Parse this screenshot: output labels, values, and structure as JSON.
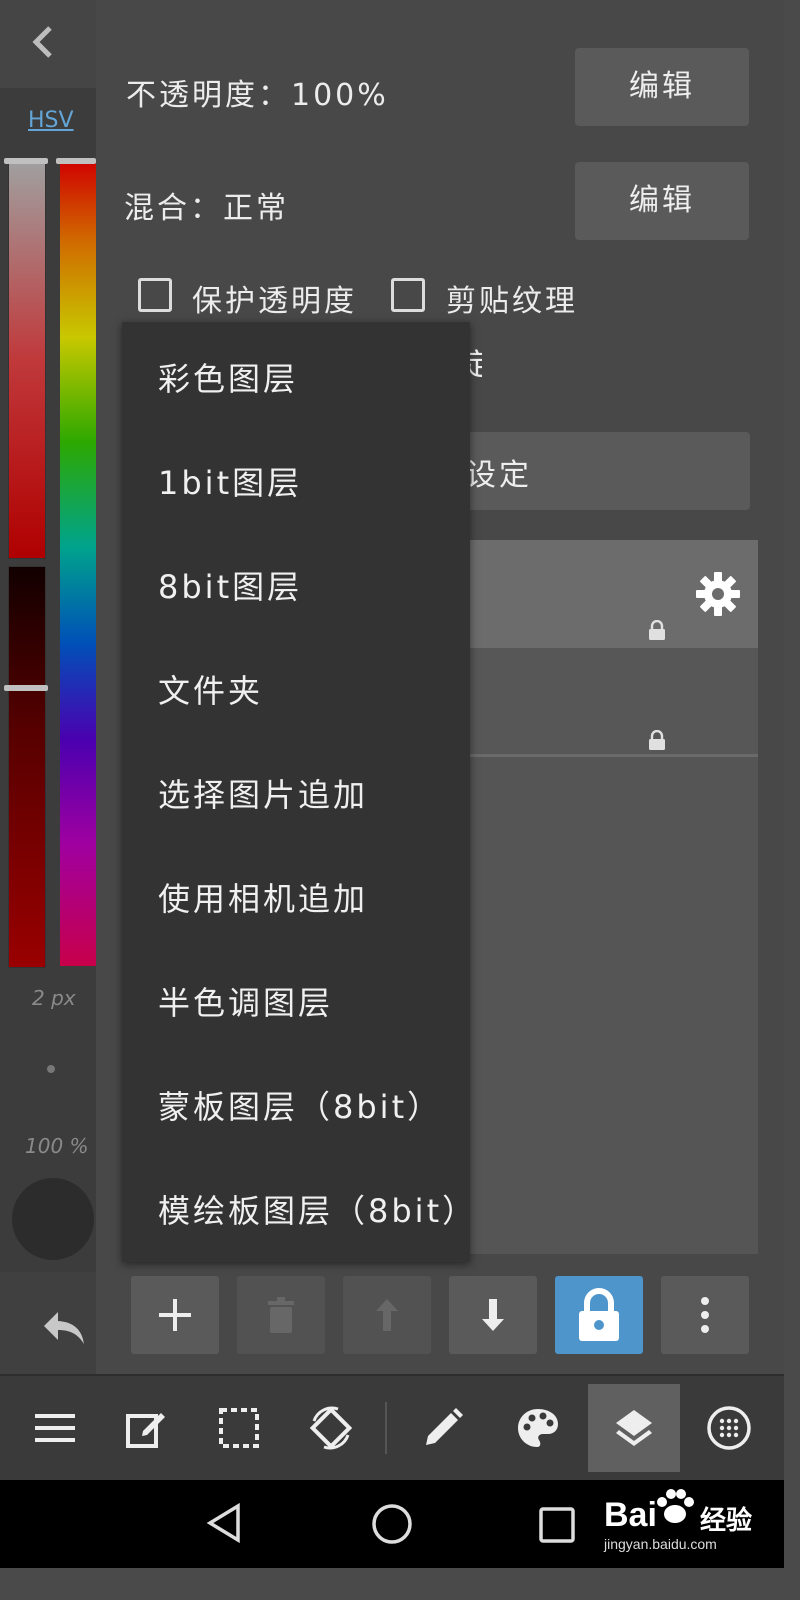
{
  "sidebar": {
    "color_mode": "HSV",
    "brush_size": "2 px",
    "opacity": "100 %"
  },
  "layer_props": {
    "opacity_label": "不透明度：100%",
    "blend_label": "混合：正常",
    "edit_label": "编辑",
    "protect_alpha": "保护透明度",
    "clipping": "剪贴纹理",
    "settings_partial": "设定",
    "hidden_trail": "定"
  },
  "add_layer_menu": {
    "items": [
      {
        "label": "彩色图层"
      },
      {
        "label": "1bit图层"
      },
      {
        "label": "8bit图层"
      },
      {
        "label": "文件夹"
      },
      {
        "label": "选择图片追加"
      },
      {
        "label": "使用相机追加"
      },
      {
        "label": "半色调图层"
      },
      {
        "label": "蒙板图层（8bit）"
      },
      {
        "label": "模绘板图层（8bit）"
      }
    ]
  },
  "layer_toolbar": [
    "add-icon",
    "trash-icon",
    "move-up-icon",
    "move-down-icon",
    "lock-icon",
    "more-icon"
  ],
  "bottom_toolbar": [
    "menu-icon",
    "edit-icon",
    "selection-icon",
    "rotate-icon",
    "pen-icon",
    "palette-icon",
    "layers-icon",
    "material-icon"
  ],
  "watermark": {
    "brand": "Bai",
    "cn": "经验",
    "url": "jingyan.baidu.com"
  },
  "colors": {
    "accent": "#4e95cb",
    "panel": "#484848",
    "menu": "#333333"
  }
}
